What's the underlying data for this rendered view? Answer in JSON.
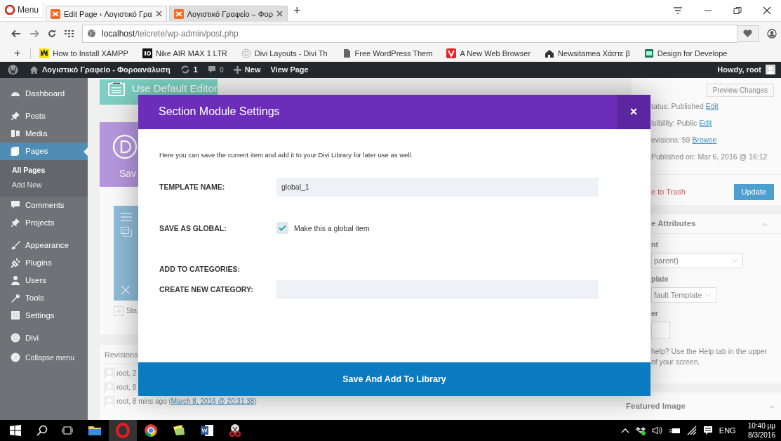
{
  "browser": {
    "menu_label": "Menu",
    "tabs": [
      {
        "title": "Edit Page ‹ Λογιστικό Γρα",
        "selected": true
      },
      {
        "title": "Λογιστικό Γραφείο – Φορ",
        "selected": false
      }
    ],
    "new_tab": "+",
    "address": "**localhost**/teicrete/wp-admin/post.php",
    "bookmark_add": "+",
    "bookmarks": [
      {
        "label": "How to Install XAMPP"
      },
      {
        "label": "Nike AIR MAX 1 LTR"
      },
      {
        "label": "Divi Layouts - Divi Th"
      },
      {
        "label": "Free WordPress Them"
      },
      {
        "label": "A New Web Browser"
      },
      {
        "label": "Newsitamea Χάστε β"
      },
      {
        "label": "Design for Develope"
      }
    ]
  },
  "admin_bar": {
    "site_name": "Λογιστικό Γραφείο - Φοροανάλυση",
    "updates": "1",
    "comments": "0",
    "new": "New",
    "view_page": "View Page",
    "greeting": "Howdy, root"
  },
  "sidebar": {
    "items": [
      {
        "label": "Dashboard",
        "selected": false
      },
      {
        "label": "Posts",
        "selected": false
      },
      {
        "label": "Media",
        "selected": false
      },
      {
        "label": "Pages",
        "selected": true,
        "children": [
          {
            "label": "All Pages",
            "selected": true
          },
          {
            "label": "Add New",
            "selected": false
          }
        ]
      },
      {
        "label": "Comments",
        "selected": false
      },
      {
        "label": "Projects",
        "selected": false
      },
      {
        "label": "Appearance",
        "selected": false
      },
      {
        "label": "Plugins",
        "selected": false
      },
      {
        "label": "Users",
        "selected": false
      },
      {
        "label": "Tools",
        "selected": false
      },
      {
        "label": "Settings",
        "selected": false
      },
      {
        "label": "Divi",
        "selected": false
      }
    ],
    "collapse": "Collapse menu"
  },
  "editor": {
    "default_editor_button": "Use Default Editor",
    "builder_button": "Sav",
    "add_row": "Sta"
  },
  "revisions": {
    "title": "Revisions",
    "rows": [
      {
        "text": "root, 2"
      },
      {
        "text": "root, 8"
      },
      {
        "text": "root, 8 mins ago (",
        "link": "March 8, 2016 @ 20:31:38",
        "suffix": ")"
      }
    ]
  },
  "publish": {
    "preview": "Preview Changes",
    "lines": [
      {
        "text": "tatus: Published",
        "link": "Edit"
      },
      {
        "text": "isibility: Public",
        "link": "Edit"
      },
      {
        "text": "evisions: 59",
        "link": "Browse"
      },
      {
        "text": "Published on: Mar 6, 2016 @ 16:12"
      }
    ],
    "trash": "e to Trash",
    "update": "Update"
  },
  "page_attributes": {
    "title": "e Attributes",
    "parent_label": "nt",
    "parent_value": "parent)",
    "template_label": "plate",
    "template_value": "fault Template",
    "order_label": "er",
    "help_lines": [
      "help? Use the Help tab in the upper",
      "of your screen."
    ]
  },
  "featured_image": {
    "title": "Featured Image"
  },
  "modal": {
    "title": "Section Module Settings",
    "close": "×",
    "intro": "Here you can save the current item and add it to your Divi Library for later use as well.",
    "fields": [
      {
        "kind": "text",
        "label": "TEMPLATE NAME:",
        "value": "global_1"
      },
      {
        "kind": "checkbox",
        "label": "SAVE AS GLOBAL:",
        "option": "Make this a global item",
        "checked": true
      },
      {
        "kind": "heading",
        "label": "ADD TO CATEGORIES:"
      },
      {
        "kind": "text",
        "label": "CREATE NEW CATEGORY:"
      }
    ],
    "save_button": "Save And Add To Library"
  },
  "taskbar": {
    "apps": [
      {
        "selected": false
      },
      {
        "selected": true
      },
      {
        "selected": false
      },
      {
        "selected": false
      },
      {
        "selected": false
      },
      {
        "selected": false
      }
    ],
    "language": "ENG",
    "time": "10:40 μμ",
    "date": "8/3/2016"
  }
}
